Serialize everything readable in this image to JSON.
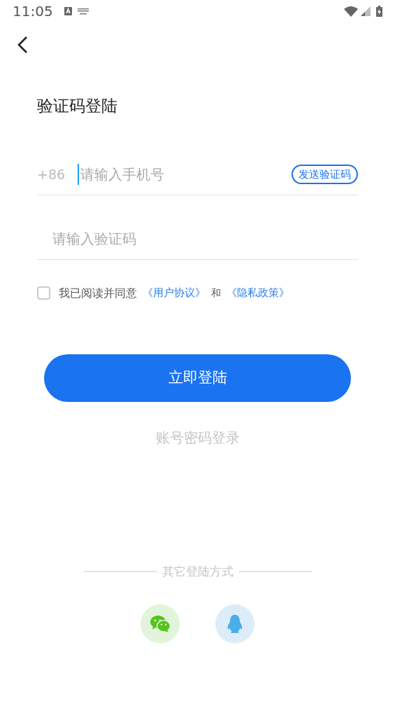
{
  "status_bar": {
    "time": "11:05"
  },
  "title": "验证码登陆",
  "phone_field": {
    "prefix": "+86",
    "placeholder": "请输入手机号",
    "focused": true,
    "send_button": "发送验证码"
  },
  "code_field": {
    "placeholder": "请输入验证码"
  },
  "agreement": {
    "checked": false,
    "text": "我已阅读并同意",
    "link_1": "《用户协议》",
    "joiner": "和",
    "link_2": "《隐私政策》"
  },
  "login_button": "立即登陆",
  "password_login_link": "账号密码登录",
  "other_logins": {
    "label": "其它登陆方式"
  }
}
